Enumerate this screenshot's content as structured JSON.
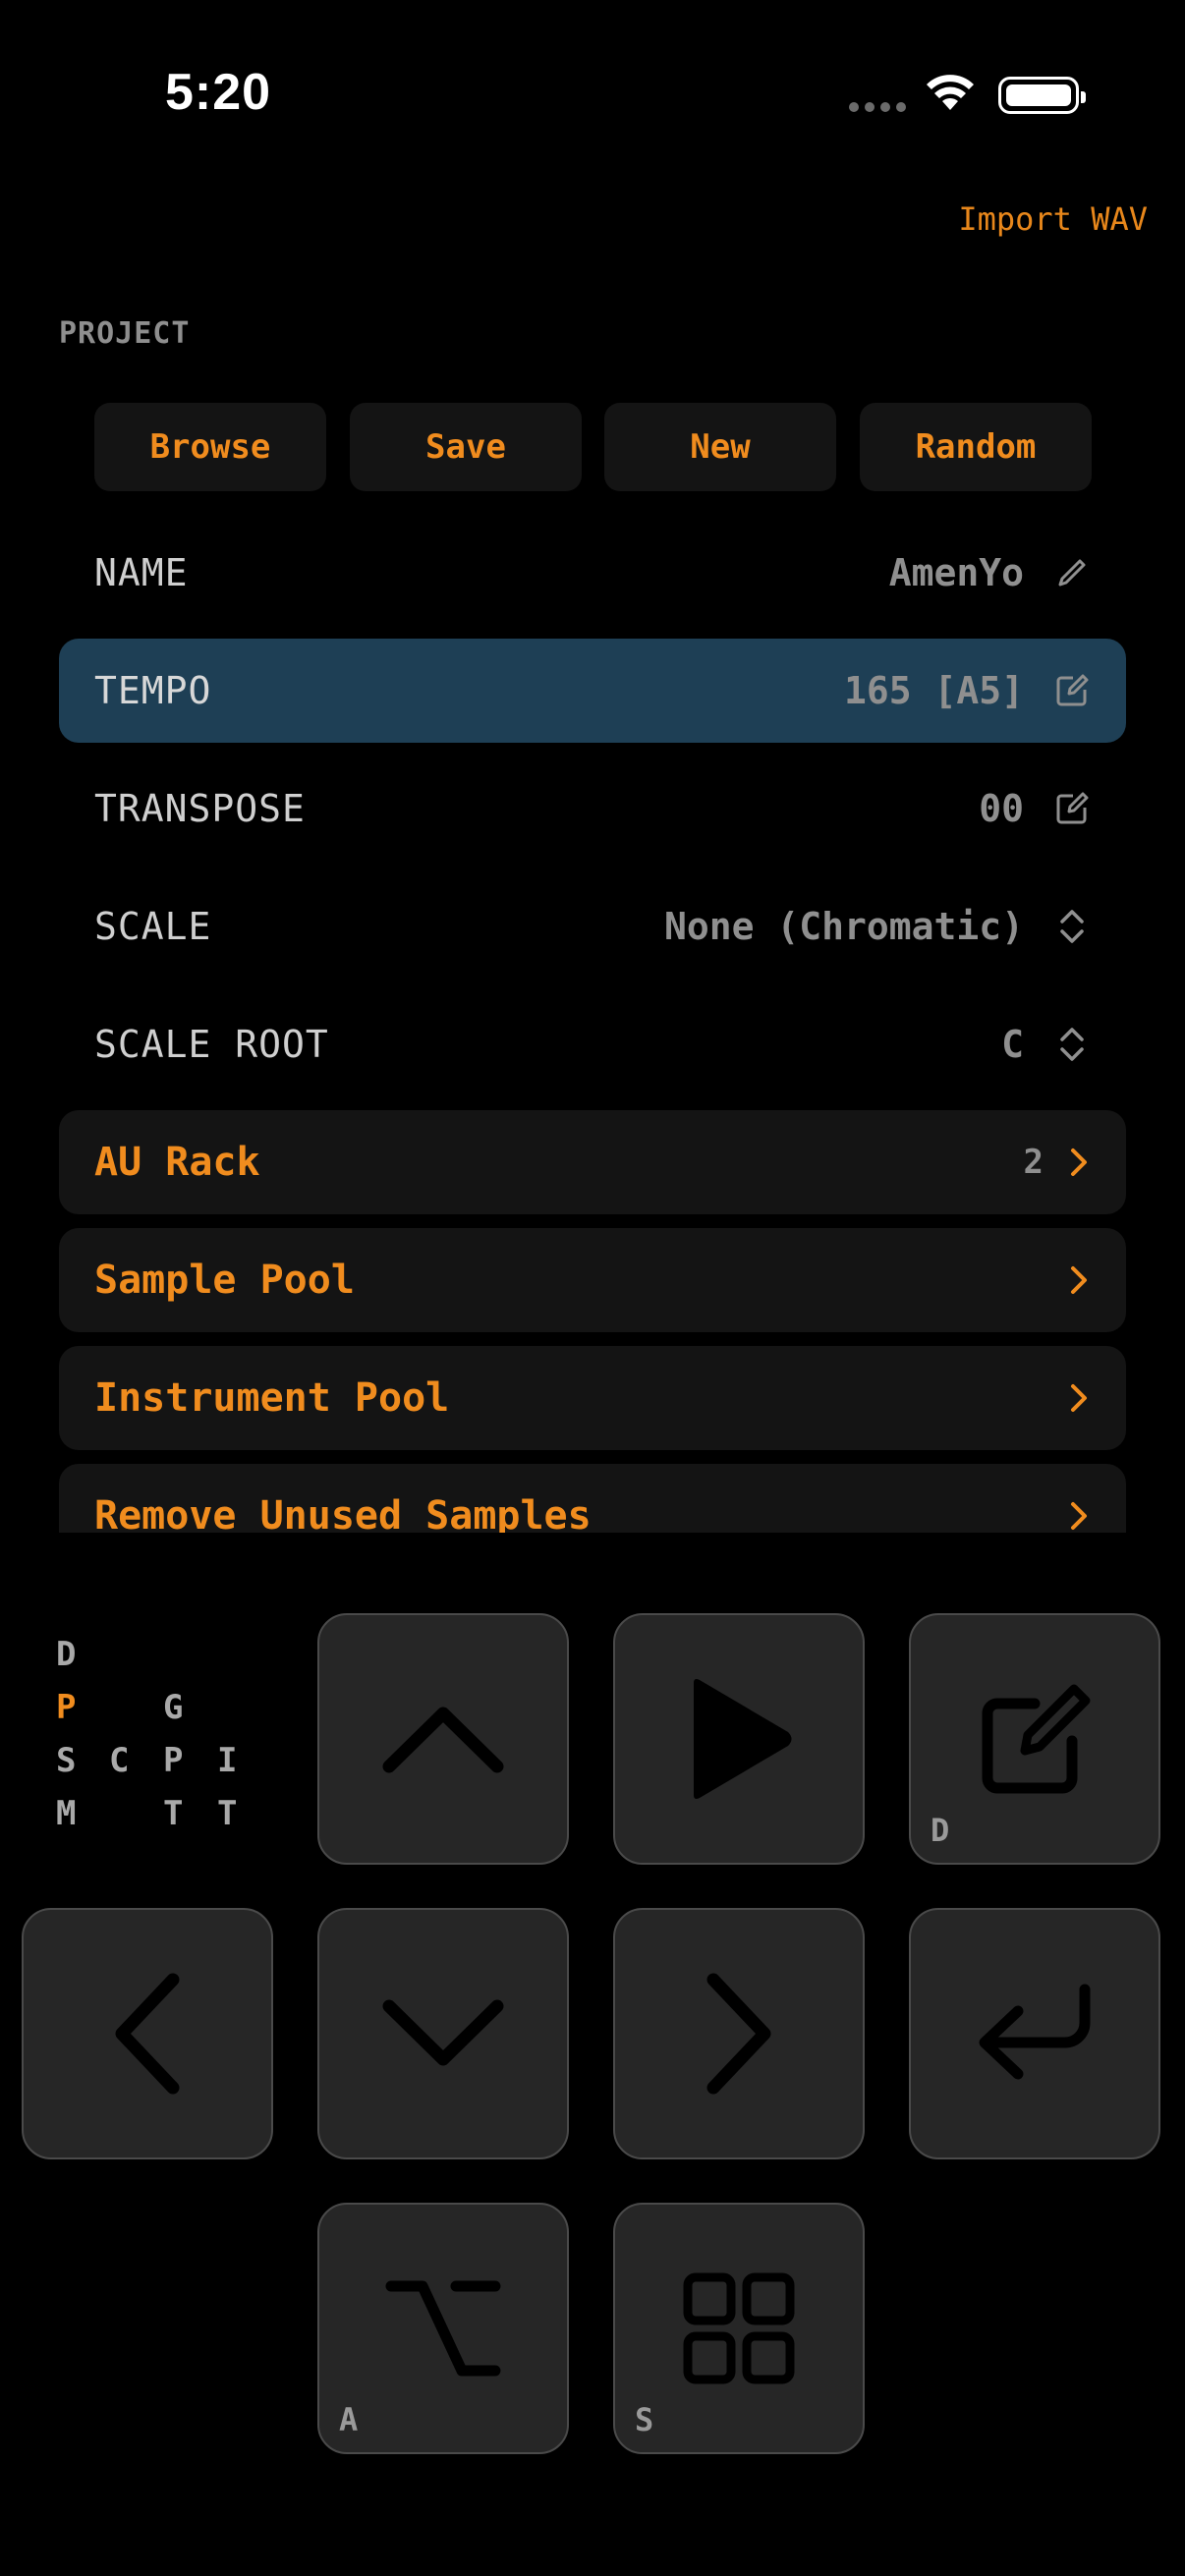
{
  "status": {
    "time": "5:20"
  },
  "header": {
    "import_label": "Import WAV"
  },
  "project": {
    "section_label": "PROJECT",
    "buttons": [
      "Browse",
      "Save",
      "New",
      "Random"
    ],
    "rows": [
      {
        "label": "NAME",
        "value": "AmenYo"
      },
      {
        "label": "TEMPO",
        "value": "165 [A5]"
      },
      {
        "label": "TRANSPOSE",
        "value": "00"
      },
      {
        "label": "SCALE",
        "value": "None (Chromatic)"
      },
      {
        "label": "SCALE ROOT",
        "value": "C"
      }
    ],
    "nav_items": [
      {
        "label": "AU Rack",
        "count": "2"
      },
      {
        "label": "Sample Pool"
      },
      {
        "label": "Instrument Pool"
      },
      {
        "label": "Remove Unused Samples"
      }
    ]
  },
  "mode_grid": {
    "d": "D",
    "p": "P",
    "g": "G",
    "s": "S",
    "c": "C",
    "p2": "P",
    "i": "I",
    "m": "M",
    "t1": "T",
    "t2": "T"
  },
  "keypad": {
    "edit_sub": "D",
    "option_sub": "A",
    "grid_sub": "S"
  },
  "colors": {
    "accent": "#f08c1e",
    "selected_row": "#1e3f55",
    "button_bg": "#141414",
    "key_bg": "#262626"
  }
}
